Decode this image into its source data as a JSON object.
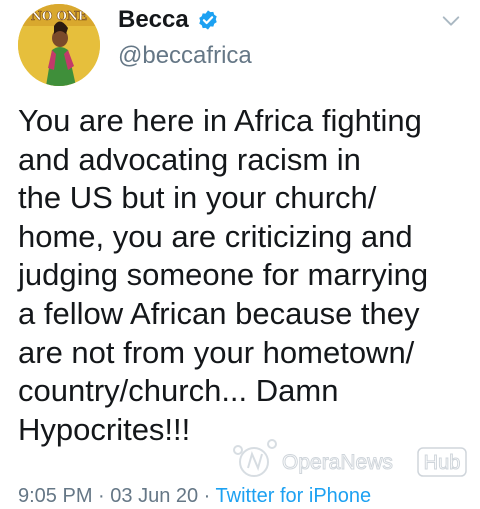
{
  "author": {
    "display_name": "Becca",
    "handle": "@beccafrica",
    "avatar_text": "NO ONE",
    "verified": true
  },
  "tweet": {
    "text": "You are here in Africa fighting\nand advocating racism in\nthe US but in your church/\nhome, you are criticizing and\njudging someone for marrying\na fellow African because they\nare not from your hometown/\ncountry/church... Damn\nHypocrites!!!",
    "time": "9:05 PM",
    "date": "03 Jun 20",
    "separator": " · ",
    "source": "Twitter for iPhone"
  },
  "watermark": {
    "brand": "OperaNews",
    "suffix": "Hub"
  },
  "colors": {
    "text": "#14171a",
    "secondary": "#657786",
    "link": "#1da1f2",
    "verified": "#1da1f2"
  }
}
